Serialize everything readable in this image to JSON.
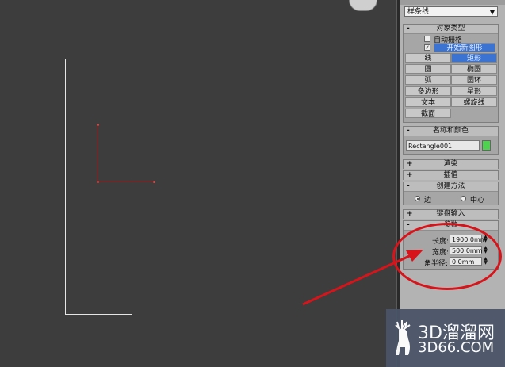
{
  "viewport": {
    "label": "viewport"
  },
  "panel": {
    "dropdown_value": "样条线",
    "object_type": {
      "title": "对象类型",
      "auto_grid": "自动栅格",
      "start_new_shape": "开始新图形",
      "buttons": [
        {
          "label": "线",
          "active": false
        },
        {
          "label": "矩形",
          "active": true
        },
        {
          "label": "圆",
          "active": false
        },
        {
          "label": "椭圆",
          "active": false
        },
        {
          "label": "弧",
          "active": false
        },
        {
          "label": "圆环",
          "active": false
        },
        {
          "label": "多边形",
          "active": false
        },
        {
          "label": "星形",
          "active": false
        },
        {
          "label": "文本",
          "active": false
        },
        {
          "label": "螺旋线",
          "active": false
        },
        {
          "label": "截面",
          "active": false
        }
      ]
    },
    "name_color": {
      "title": "名称和颜色",
      "name": "Rectangle001",
      "color": "#4fd24f"
    },
    "rendering": {
      "title": "渲染"
    },
    "interpolation": {
      "title": "插值"
    },
    "creation_method": {
      "title": "创建方法",
      "edge": "边",
      "center": "中心",
      "selected": "边"
    },
    "keyboard_entry": {
      "title": "键盘输入"
    },
    "parameters": {
      "title": "参数",
      "length_label": "长度:",
      "length_value": "1900.0mm",
      "width_label": "宽度:",
      "width_value": "500.0mm",
      "corner_label": "角半径:",
      "corner_value": "0.0mm"
    }
  },
  "watermark": {
    "title": "3D溜溜网",
    "url": "3D66.COM"
  },
  "colors": {
    "annotation": "#d8141b",
    "active_button": "#3a73d2"
  }
}
